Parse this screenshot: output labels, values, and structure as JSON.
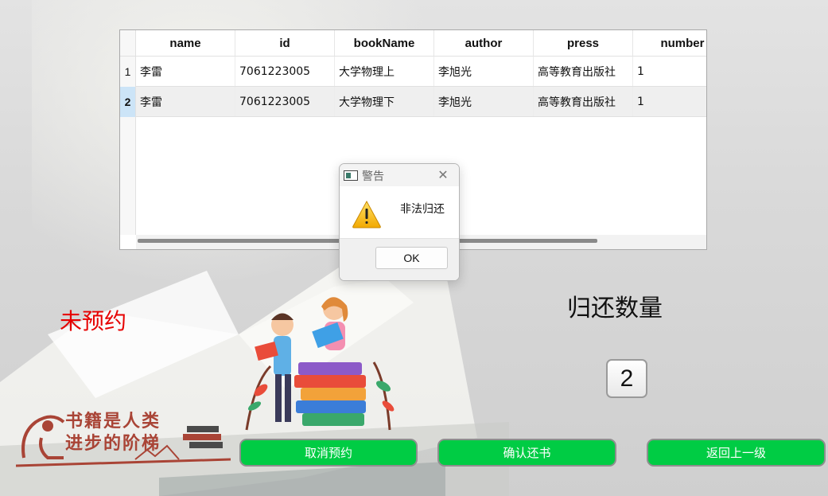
{
  "table": {
    "columns": [
      "name",
      "id",
      "bookName",
      "author",
      "press",
      "number"
    ],
    "row_numbers": [
      "1",
      "2"
    ],
    "rows": [
      {
        "name": "李雷",
        "id": "7061223005",
        "bookName": "大学物理上",
        "author": "李旭光",
        "press": "高等教育出版社",
        "number": "1"
      },
      {
        "name": "李雷",
        "id": "7061223005",
        "bookName": "大学物理下",
        "author": "李旭光",
        "press": "高等教育出版社",
        "number": "1"
      }
    ],
    "selected_row": 2
  },
  "dialog": {
    "title": "警告",
    "message": "非法归还",
    "ok_label": "OK",
    "icon": "warning-icon"
  },
  "status_label": "未预约",
  "return_count": {
    "title": "归还数量",
    "value": "2"
  },
  "buttons": {
    "cancel_reservation": "取消预约",
    "confirm_return": "确认还书",
    "back": "返回上一级"
  },
  "logo": {
    "line1": "书籍是人类",
    "line2": "进步的阶梯"
  },
  "colors": {
    "button_green": "#00cc44",
    "status_red": "#e60000",
    "selected_row_header": "#cce4f7",
    "logo_brown": "#a94436"
  }
}
